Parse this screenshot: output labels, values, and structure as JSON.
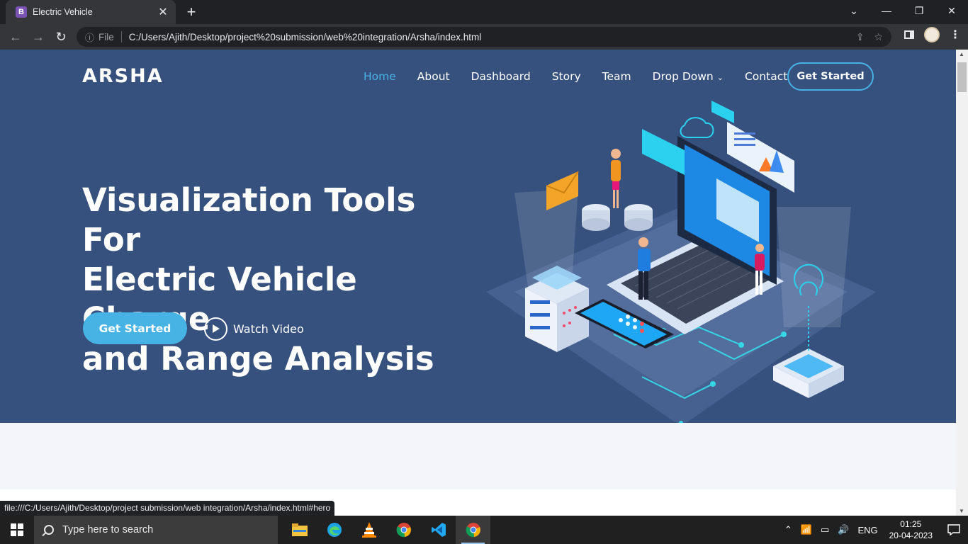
{
  "browser": {
    "tab_title": "Electric Vehicle",
    "tab_favicon_letter": "B",
    "omnibox_scheme": "File",
    "url": "C:/Users/Ajith/Desktop/project%20submission/web%20integration/Arsha/index.html",
    "status_url": "file:///C:/Users/Ajith/Desktop/project submission/web integration/Arsha/index.html#hero"
  },
  "site": {
    "logo": "ARSHA",
    "nav": {
      "home": "Home",
      "about": "About",
      "dashboard": "Dashboard",
      "story": "Story",
      "team": "Team",
      "dropdown": "Drop Down",
      "contact": "Contact",
      "cta": "Get Started"
    },
    "hero": {
      "title_line1": "Visualization Tools For",
      "title_line2": "Electric Vehicle Charge",
      "title_line3": "and Range Analysis",
      "cta": "Get Started",
      "watch_video": "Watch Video"
    },
    "colors": {
      "hero_bg": "#37517e",
      "accent": "#47b2e4",
      "section_bg": "#f3f5fa"
    }
  },
  "taskbar": {
    "search_placeholder": "Type here to search",
    "language": "ENG",
    "time": "01:25",
    "date": "20-04-2023"
  }
}
